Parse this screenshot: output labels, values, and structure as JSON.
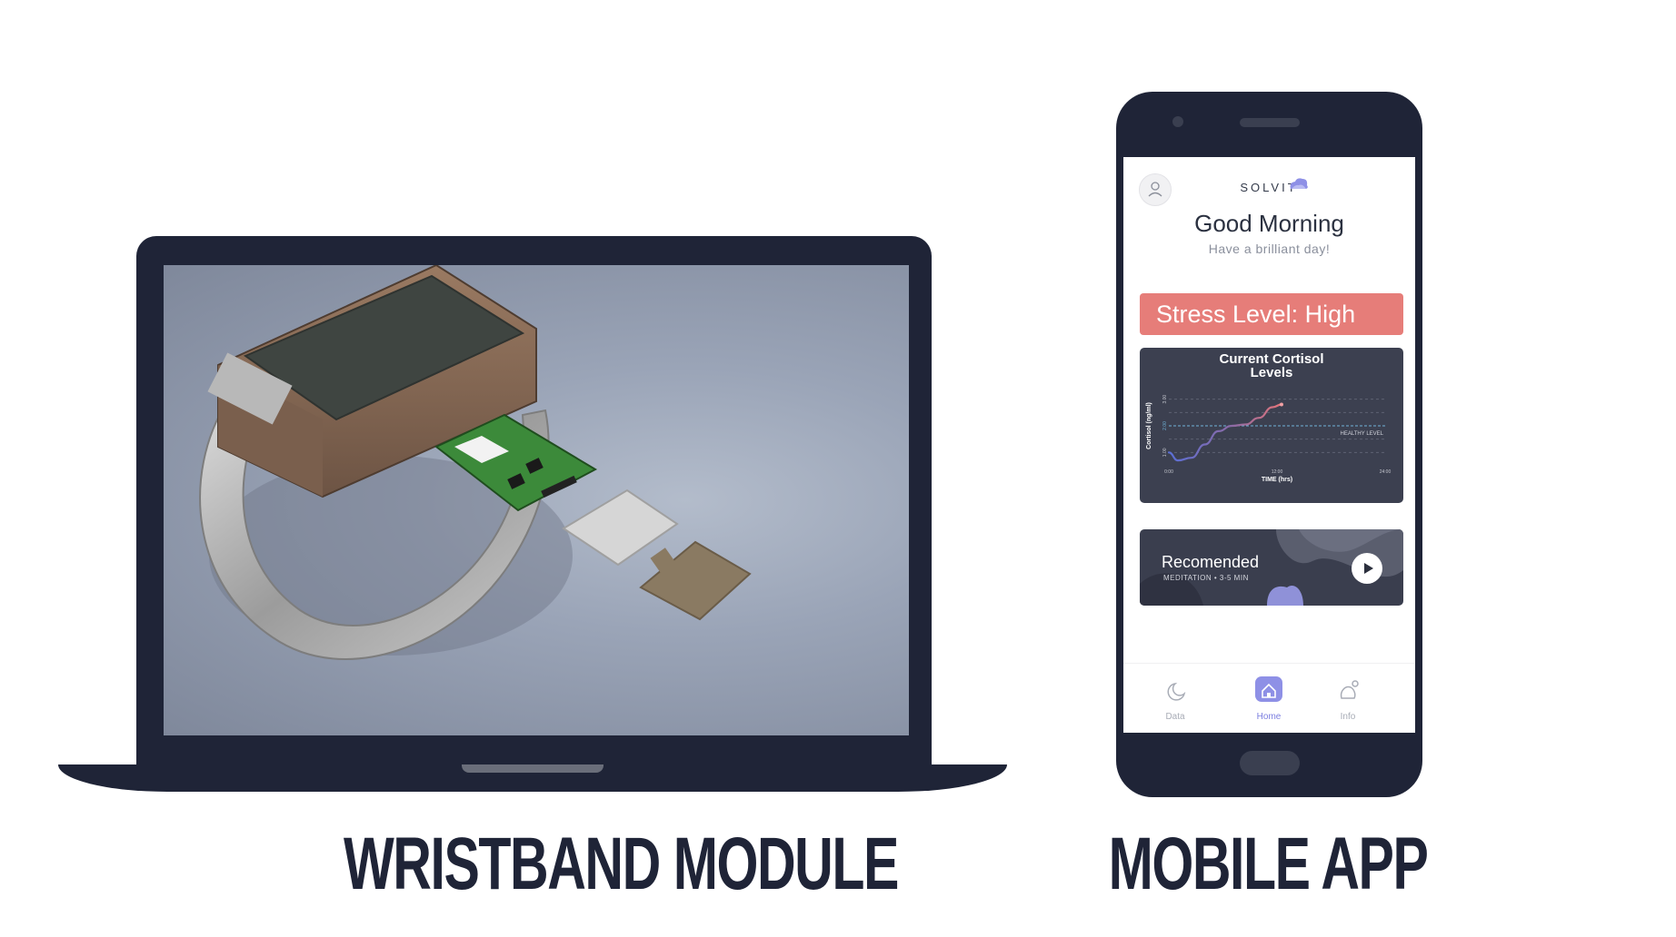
{
  "captions": {
    "left": "WRISTBAND MODULE",
    "right": "MOBILE APP"
  },
  "app": {
    "brand": "SOLVIT",
    "greeting": "Good Morning",
    "subgreeting": "Have a brilliant day!",
    "stress_label": "Stress Level: High",
    "chart_title": "Current Cortisol Levels",
    "recommendation": {
      "title": "Recomended",
      "subtitle": "MEDITATION • 3-5 MIN"
    },
    "nav": [
      {
        "label": "Data",
        "icon": "moon-icon"
      },
      {
        "label": "Home",
        "icon": "home-icon",
        "active": true
      },
      {
        "label": "Info",
        "icon": "info-icon"
      }
    ],
    "colors": {
      "accent": "#7c7fe0",
      "stress": "#e67d79",
      "dark": "#1f2437",
      "card": "#3c4050"
    }
  },
  "chart_data": {
    "type": "line",
    "title": "Current Cortisol Levels",
    "xlabel": "TIME (hrs)",
    "ylabel": "Cortisol (ng/ml)",
    "x_ticks": [
      "0:00",
      "12:00",
      "24:00"
    ],
    "y_ticks": [
      "1.00",
      "2.00",
      "3.00"
    ],
    "reference_line": {
      "label": "HEALTHY LEVEL",
      "value": 2.0
    },
    "xlim": [
      0,
      24
    ],
    "ylim": [
      0.5,
      3.5
    ],
    "series": [
      {
        "x": [
          0,
          1,
          2.5,
          4,
          5.5,
          7,
          8.5,
          10,
          11.5,
          12.5
        ],
        "y": [
          1.0,
          0.7,
          0.8,
          1.3,
          1.8,
          2.0,
          2.05,
          2.3,
          2.7,
          2.8
        ]
      }
    ],
    "grid": true
  }
}
